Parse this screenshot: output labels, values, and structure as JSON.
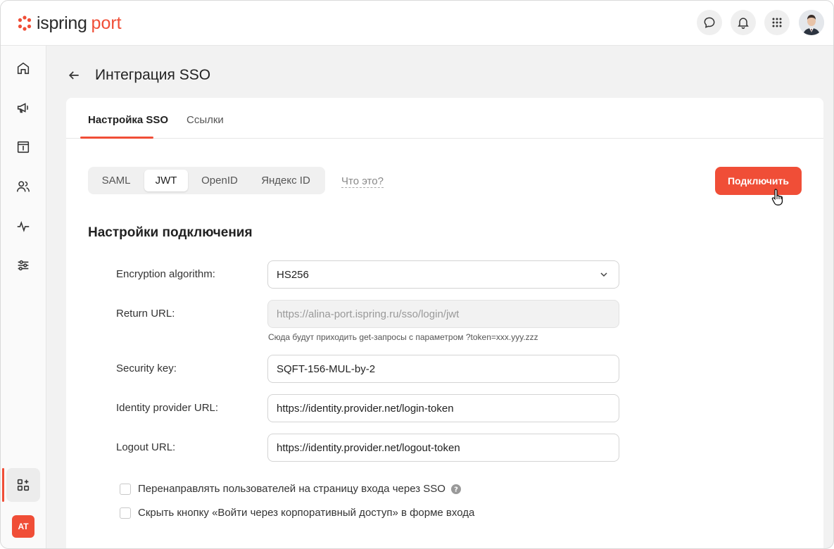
{
  "header": {
    "logo_text": "ispring",
    "logo_accent": "port",
    "brand_color": "#f04e37",
    "icons": [
      "chat-icon",
      "bell-icon",
      "apps-grid-icon"
    ]
  },
  "sidebar": {
    "items": [
      "home-icon",
      "megaphone-icon",
      "catalog-icon",
      "users-icon",
      "activity-icon",
      "settings-sliders-icon",
      "add-widget-icon"
    ],
    "user_initials": "AT"
  },
  "page": {
    "title": "Интеграция SSO"
  },
  "tabs": [
    {
      "label": "Настройка SSO",
      "active": true
    },
    {
      "label": "Ссылки",
      "active": false
    }
  ],
  "protocols": [
    {
      "label": "SAML",
      "active": false
    },
    {
      "label": "JWT",
      "active": true
    },
    {
      "label": "OpenID",
      "active": false
    },
    {
      "label": "Яндекс ID",
      "active": false
    }
  ],
  "what_link": "Что это?",
  "connect_button": "Подключить",
  "section_title": "Настройки подключения",
  "fields": {
    "encryption": {
      "label": "Encryption algorithm:",
      "value": "HS256"
    },
    "return_url": {
      "label": "Return URL:",
      "value": "https://alina-port.ispring.ru/sso/login/jwt",
      "hint": "Сюда будут приходить get-запросы с параметром ?token=xxx.yyy.zzz"
    },
    "security_key": {
      "label": "Security key:",
      "value": "SQFT-156-MUL-by-2"
    },
    "identity_url": {
      "label": "Identity provider URL:",
      "value": "https://identity.provider.net/login-token"
    },
    "logout_url": {
      "label": "Logout URL:",
      "value": "https://identity.provider.net/logout-token"
    }
  },
  "checkboxes": [
    {
      "label": "Перенаправлять пользователей на страницу входа через SSO",
      "checked": false,
      "has_help": true
    },
    {
      "label": "Скрыть кнопку «Войти через корпоративный доступ» в форме входа",
      "checked": false,
      "has_help": false
    }
  ]
}
